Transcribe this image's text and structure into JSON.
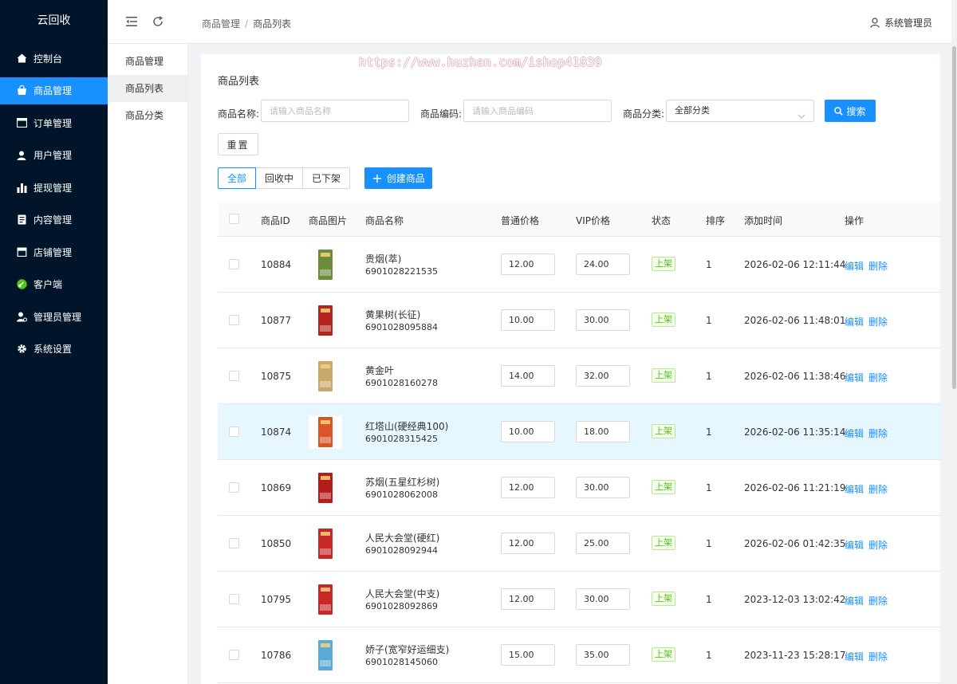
{
  "app": {
    "title": "云回收"
  },
  "sidebar": {
    "items": [
      {
        "label": "控制台",
        "icon": "home-icon"
      },
      {
        "label": "商品管理",
        "icon": "shopping-bag-icon"
      },
      {
        "label": "订单管理",
        "icon": "order-icon"
      },
      {
        "label": "用户管理",
        "icon": "user-icon"
      },
      {
        "label": "提现管理",
        "icon": "bar-chart-icon"
      },
      {
        "label": "内容管理",
        "icon": "document-icon"
      },
      {
        "label": "店铺管理",
        "icon": "store-icon"
      },
      {
        "label": "客户端",
        "icon": "miniprogram-icon"
      },
      {
        "label": "管理员管理",
        "icon": "admin-icon"
      },
      {
        "label": "系统设置",
        "icon": "gear-icon"
      }
    ],
    "active_index": 1
  },
  "submenu": {
    "items": [
      {
        "label": "商品管理"
      },
      {
        "label": "商品列表"
      },
      {
        "label": "商品分类"
      }
    ],
    "active_index": 1
  },
  "header": {
    "breadcrumb": [
      "商品管理",
      "商品列表"
    ],
    "user": "系统管理员"
  },
  "watermark": "https://www.huzhan.com/ishop41839",
  "card": {
    "title": "商品列表",
    "filters": {
      "name_label": "商品名称:",
      "name_placeholder": "请输入商品名称",
      "code_label": "商品编码:",
      "code_placeholder": "请输入商品编码",
      "category_label": "商品分类:",
      "category_value": "全部分类",
      "search_label": "搜索",
      "reset_label": "重置"
    },
    "tabs": [
      {
        "label": "全部"
      },
      {
        "label": "回收中"
      },
      {
        "label": "已下架"
      }
    ],
    "active_tab": 0,
    "create_label": "创建商品"
  },
  "table": {
    "columns": [
      "商品ID",
      "商品图片",
      "商品名称",
      "普通价格",
      "VIP价格",
      "状态",
      "排序",
      "添加时间",
      "操作"
    ],
    "edit_label": "编辑",
    "delete_label": "删除",
    "rows": [
      {
        "id": "10884",
        "name": "贵烟(萃)",
        "code": "6901028221535",
        "price": "12.00",
        "vip": "24.00",
        "status": "上架",
        "sort": "1",
        "time": "2026-02-06 12:11:44",
        "img_color": "#6b8a3a"
      },
      {
        "id": "10877",
        "name": "黄果树(长征)",
        "code": "6901028095884",
        "price": "10.00",
        "vip": "30.00",
        "status": "上架",
        "sort": "1",
        "time": "2026-02-06 11:48:01",
        "img_color": "#b3261e"
      },
      {
        "id": "10875",
        "name": "黄金叶",
        "code": "6901028160278",
        "price": "14.00",
        "vip": "32.00",
        "status": "上架",
        "sort": "1",
        "time": "2026-02-06 11:38:46",
        "img_color": "#c9a86b"
      },
      {
        "id": "10874",
        "name": "红塔山(硬经典100)",
        "code": "6901028315425",
        "price": "10.00",
        "vip": "18.00",
        "status": "上架",
        "sort": "1",
        "time": "2026-02-06 11:35:14",
        "img_color": "#d8572a"
      },
      {
        "id": "10869",
        "name": "苏烟(五星红杉树)",
        "code": "6901028062008",
        "price": "12.00",
        "vip": "30.00",
        "status": "上架",
        "sort": "1",
        "time": "2026-02-06 11:21:19",
        "img_color": "#b71c1c"
      },
      {
        "id": "10850",
        "name": "人民大会堂(硬红)",
        "code": "6901028092944",
        "price": "12.00",
        "vip": "25.00",
        "status": "上架",
        "sort": "1",
        "time": "2026-02-06 01:42:35",
        "img_color": "#c62828"
      },
      {
        "id": "10795",
        "name": "人民大会堂(中支)",
        "code": "6901028092869",
        "price": "12.00",
        "vip": "30.00",
        "status": "上架",
        "sort": "1",
        "time": "2023-12-03 13:02:42",
        "img_color": "#c62828"
      },
      {
        "id": "10786",
        "name": "娇子(宽窄好运细支)",
        "code": "6901028145060",
        "price": "15.00",
        "vip": "35.00",
        "status": "上架",
        "sort": "1",
        "time": "2023-11-23 15:28:17",
        "img_color": "#5aa9d6"
      }
    ],
    "hover_row": 3
  },
  "colors": {
    "sidebar_bg": "#001529",
    "primary": "#1890ff",
    "status_green": "#52c41a"
  }
}
